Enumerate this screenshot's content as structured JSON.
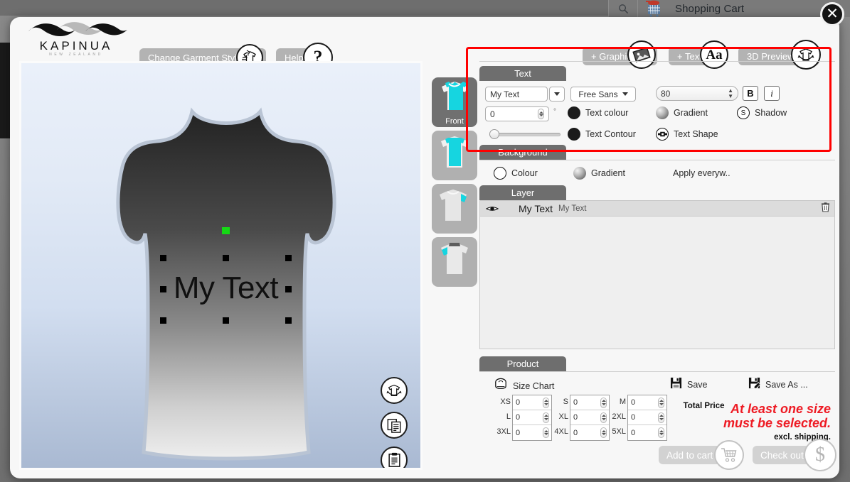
{
  "site_header": {
    "search_icon": "search-icon",
    "cart_icon": "shopping-cart-icon",
    "cart_title": "Shopping Cart",
    "close_label": "✕"
  },
  "brand": {
    "wordmark": "KAPINUA",
    "tagline": "NEW ZEALAND",
    "logo_icon": "kapinua-wave-logo"
  },
  "toolbar": {
    "change_garment_label": "Change Garment Style",
    "change_garment_icon": "garment-swap-icon",
    "help_label": "Help",
    "help_icon": "question-mark-icon",
    "add_graphic_label": "+ Graphic",
    "add_graphic_icon": "image-icon",
    "add_text_label": "+ Text",
    "add_text_icon": "aa-icon",
    "preview_3d_label": "3D Preview",
    "preview_3d_icon": "shirt-rotate-icon"
  },
  "canvas": {
    "artwork_text": "My Text",
    "rotate_handle": "rotate-handle",
    "fab_rotate_icon": "shirt-rotate-icon",
    "fab_copy_icon": "copy-icon",
    "fab_paste_icon": "paste-icon"
  },
  "thumbnails": [
    {
      "label": "Front",
      "name": "thumb-front",
      "selected": true
    },
    {
      "label": "",
      "name": "thumb-back",
      "selected": false
    },
    {
      "label": "",
      "name": "thumb-left",
      "selected": false
    },
    {
      "label": "",
      "name": "thumb-right",
      "selected": false
    }
  ],
  "text_section": {
    "tab_label": "Text",
    "text_value": "My Text",
    "font_value": "Free Sans",
    "size_value": "80",
    "bold_label": "B",
    "italic_label": "i",
    "rotation_value": "0",
    "degree_symbol": "°",
    "opacity_value": 8,
    "text_colour_label": "Text colour",
    "gradient_label": "Gradient",
    "shadow_label": "Shadow",
    "text_contour_label": "Text Contour",
    "text_shape_label": "Text Shape",
    "shadow_icon": "shadow-s-icon",
    "text_shape_icon": "text-shape-icon"
  },
  "background_section": {
    "tab_label": "Background",
    "colour_label": "Colour",
    "gradient_label": "Gradient",
    "apply_everywhere_label": "Apply everyw.."
  },
  "layer_section": {
    "tab_label": "Layer",
    "eye_icon": "eye-icon",
    "trash_icon": "trash-icon",
    "rows": [
      {
        "name": "My Text",
        "content": "My Text"
      }
    ]
  },
  "product_section": {
    "tab_label": "Product",
    "size_chart_label": "Size Chart",
    "size_chart_icon": "tape-measure-icon",
    "save_label": "Save",
    "save_icon": "floppy-disk-icon",
    "save_as_label": "Save As ...",
    "save_as_icon": "floppy-disk-pencil-icon",
    "sizes": [
      {
        "label": "XS",
        "value": "0"
      },
      {
        "label": "L",
        "value": "0"
      },
      {
        "label": "3XL",
        "value": "0"
      },
      {
        "label": "S",
        "value": "0"
      },
      {
        "label": "XL",
        "value": "0"
      },
      {
        "label": "4XL",
        "value": "0"
      },
      {
        "label": "M",
        "value": "0"
      },
      {
        "label": "2XL",
        "value": "0"
      },
      {
        "label": "5XL",
        "value": "0"
      }
    ],
    "total_price_label": "Total Price",
    "warning_line1": "At least one size",
    "warning_line2": "must be selected.",
    "warning_color": "#ee1b24",
    "excl_shipping_label": "excl. shipping.",
    "add_to_cart_label": "Add to cart",
    "add_to_cart_icon": "cart-icon",
    "check_out_label": "Check out",
    "check_out_icon": "dollar-icon"
  },
  "highlight": {
    "color": "#ff0000"
  }
}
